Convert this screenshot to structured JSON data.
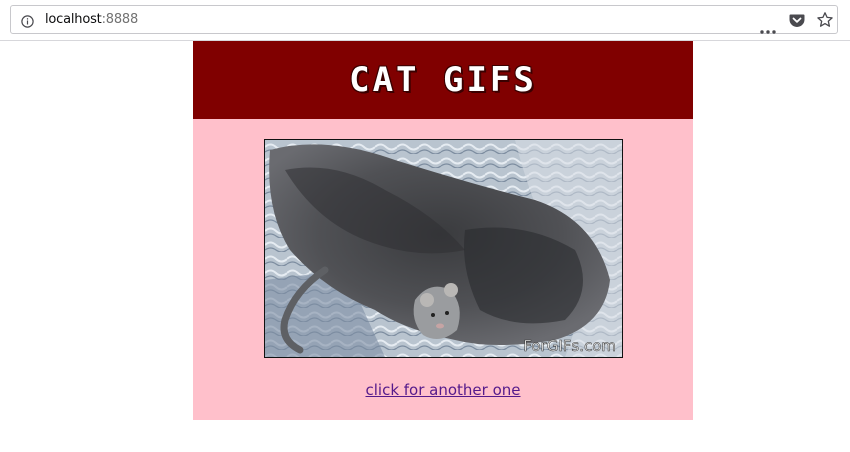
{
  "browser": {
    "url_host": "localhost",
    "url_port": ":8888"
  },
  "page": {
    "title": "Cat GIFs",
    "link_label": "click for another one",
    "gif_watermark": "ForGIFs.com"
  },
  "colors": {
    "banner": "#800000",
    "card": "#ffc0cb",
    "link": "#551a8b"
  },
  "icons": [
    "info-icon",
    "page-actions-icon",
    "pocket-icon",
    "star-icon"
  ]
}
